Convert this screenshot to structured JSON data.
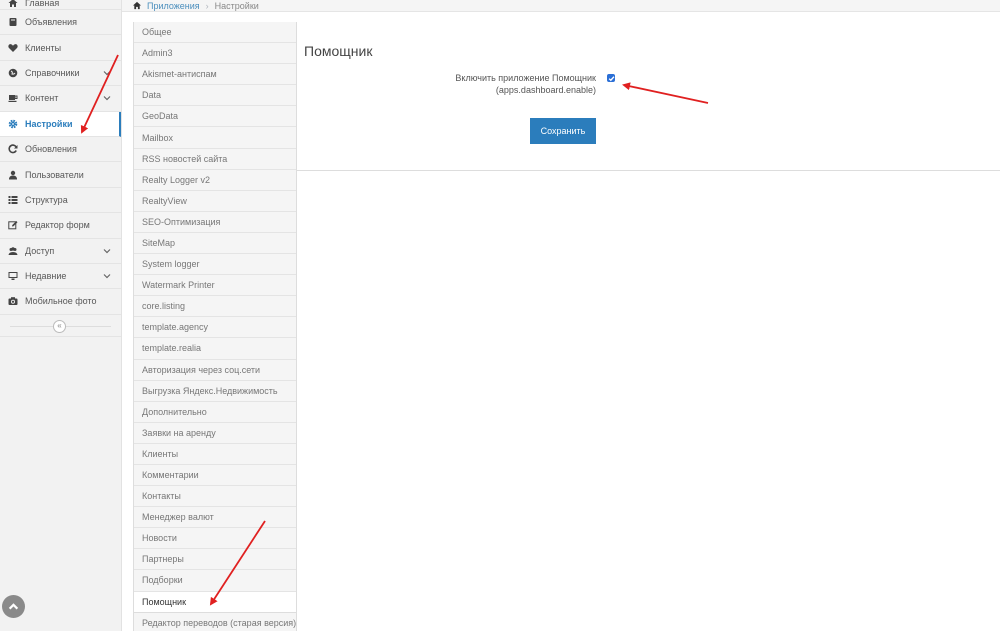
{
  "sidebar": {
    "items": [
      {
        "label": "Главная",
        "icon": "home-icon"
      },
      {
        "label": "Объявления",
        "icon": "book-icon"
      },
      {
        "label": "Клиенты",
        "icon": "heart-icon"
      },
      {
        "label": "Справочники",
        "icon": "globe-icon"
      },
      {
        "label": "Контент",
        "icon": "coffee-icon"
      },
      {
        "label": "Настройки",
        "icon": "gear-icon"
      },
      {
        "label": "Обновления",
        "icon": "refresh-icon"
      },
      {
        "label": "Пользователи",
        "icon": "user-icon"
      },
      {
        "label": "Структура",
        "icon": "list-icon"
      },
      {
        "label": "Редактор форм",
        "icon": "edit-icon"
      },
      {
        "label": "Доступ",
        "icon": "users-icon"
      },
      {
        "label": "Недавние",
        "icon": "monitor-icon"
      },
      {
        "label": "Мобильное фото",
        "icon": "camera-icon"
      }
    ],
    "collapse_glyph": "«"
  },
  "breadcrumb": {
    "link": "Приложения",
    "separator": "›",
    "current": "Настройки"
  },
  "settings_menu": {
    "items": [
      "Общее",
      "Admin3",
      "Akismet-антиспам",
      "Data",
      "GeoData",
      "Mailbox",
      "RSS новостей сайта",
      "Realty Logger v2",
      "RealtyView",
      "SEO-Оптимизация",
      "SiteMap",
      "System logger",
      "Watermark Printer",
      "core.listing",
      "template.agency",
      "template.realia",
      "Авторизация через соц.сети",
      "Выгрузка Яндекс.Недвижимость",
      "Дополнительно",
      "Заявки на аренду",
      "Клиенты",
      "Комментарии",
      "Контакты",
      "Менеджер валют",
      "Новости",
      "Партнеры",
      "Подборки",
      "Помощник",
      "Редактор переводов (старая версия)"
    ]
  },
  "panel": {
    "title": "Помощник",
    "field_label": "Включить приложение Помощник",
    "field_key": "(apps.dashboard.enable)",
    "checkbox_checked": true,
    "save_label": "Сохранить"
  },
  "colors": {
    "accent": "#2b7dbc",
    "annotation": "#e02020"
  }
}
